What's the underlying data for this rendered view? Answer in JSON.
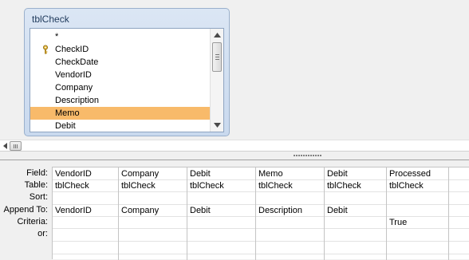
{
  "table_window": {
    "title": "tblCheck",
    "fields": [
      "*",
      "CheckID",
      "CheckDate",
      "VendorID",
      "Company",
      "Description",
      "Memo",
      "Debit"
    ],
    "selected_field": "Memo",
    "primary_key_field": "CheckID"
  },
  "grid": {
    "row_labels": {
      "field": "Field:",
      "table": "Table:",
      "sort": "Sort:",
      "append_to": "Append To:",
      "criteria": "Criteria:",
      "or": "or:"
    },
    "columns": [
      {
        "field": "VendorID",
        "table": "tblCheck",
        "sort": "",
        "append_to": "VendorID",
        "criteria": "",
        "or": ""
      },
      {
        "field": "Company",
        "table": "tblCheck",
        "sort": "",
        "append_to": "Company",
        "criteria": "",
        "or": ""
      },
      {
        "field": "Debit",
        "table": "tblCheck",
        "sort": "",
        "append_to": "Debit",
        "criteria": "",
        "or": ""
      },
      {
        "field": "Memo",
        "table": "tblCheck",
        "sort": "",
        "append_to": "Description",
        "criteria": "",
        "or": ""
      },
      {
        "field": "Debit",
        "table": "tblCheck",
        "sort": "",
        "append_to": "Debit",
        "criteria": "",
        "or": ""
      },
      {
        "field": "Processed",
        "table": "tblCheck",
        "sort": "",
        "append_to": "",
        "criteria": "True",
        "or": ""
      }
    ]
  },
  "colors": {
    "selected_highlight": "#f8ba6a",
    "table_window_border": "#9ab0cc",
    "title_text": "#1e395b"
  },
  "icons": {
    "primary_key": "key-icon",
    "scroll_up": "arrow-up-icon",
    "scroll_down": "arrow-down-icon",
    "scroll_left": "arrow-left-icon"
  }
}
